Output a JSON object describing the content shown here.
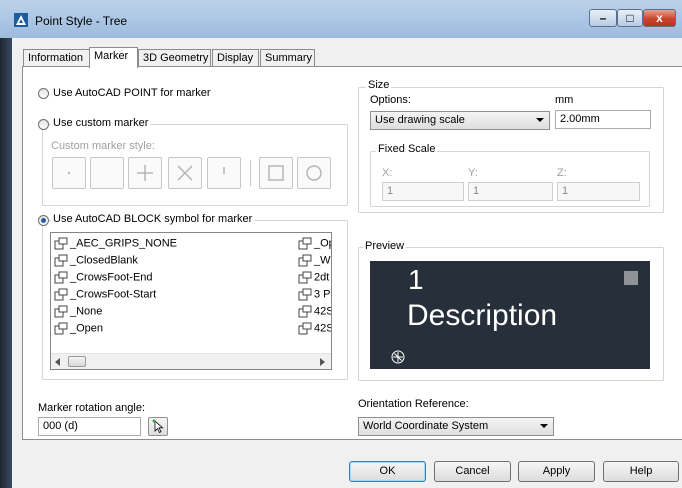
{
  "window": {
    "title": "Point Style - Tree",
    "minimize": "–",
    "maximize": "□",
    "close": "x"
  },
  "tabs": [
    {
      "label": "Information",
      "active": false
    },
    {
      "label": "Marker",
      "active": true
    },
    {
      "label": "3D Geometry",
      "active": false
    },
    {
      "label": "Display",
      "active": false
    },
    {
      "label": "Summary",
      "active": false
    }
  ],
  "marker": {
    "opt_point": "Use AutoCAD POINT for marker",
    "opt_custom": "Use custom marker",
    "custom_style_label": "Custom marker style:",
    "opt_block": "Use AutoCAD BLOCK symbol for marker",
    "selected_option": "block"
  },
  "blocks": {
    "col1": [
      "_AEC_GRIPS_NONE",
      "_ClosedBlank",
      "_CrowsFoot-End",
      "_CrowsFoot-Start",
      "_None",
      "_Open"
    ],
    "col2": [
      "_Op",
      "_W",
      "2dt",
      "3 P",
      "42S",
      "42S"
    ]
  },
  "size": {
    "title": "Size",
    "options_label": "Options:",
    "units_label": "mm",
    "option_value": "Use drawing scale",
    "size_value": "2.00mm"
  },
  "fixed_scale": {
    "title": "Fixed Scale",
    "x_label": "X:",
    "y_label": "Y:",
    "z_label": "Z:",
    "x": "1",
    "y": "1",
    "z": "1"
  },
  "preview": {
    "title": "Preview",
    "line1": "1",
    "line2": "Description"
  },
  "rotation": {
    "label": "Marker rotation angle:",
    "value": "000 (d)"
  },
  "orientation": {
    "label": "Orientation Reference:",
    "value": "World Coordinate System"
  },
  "buttons": {
    "ok": "OK",
    "cancel": "Cancel",
    "apply": "Apply",
    "help": "Help"
  },
  "colors": {
    "accent": "#2a5b9c",
    "preview_bg": "#27303a",
    "title_bar": "#bcd2ea"
  }
}
